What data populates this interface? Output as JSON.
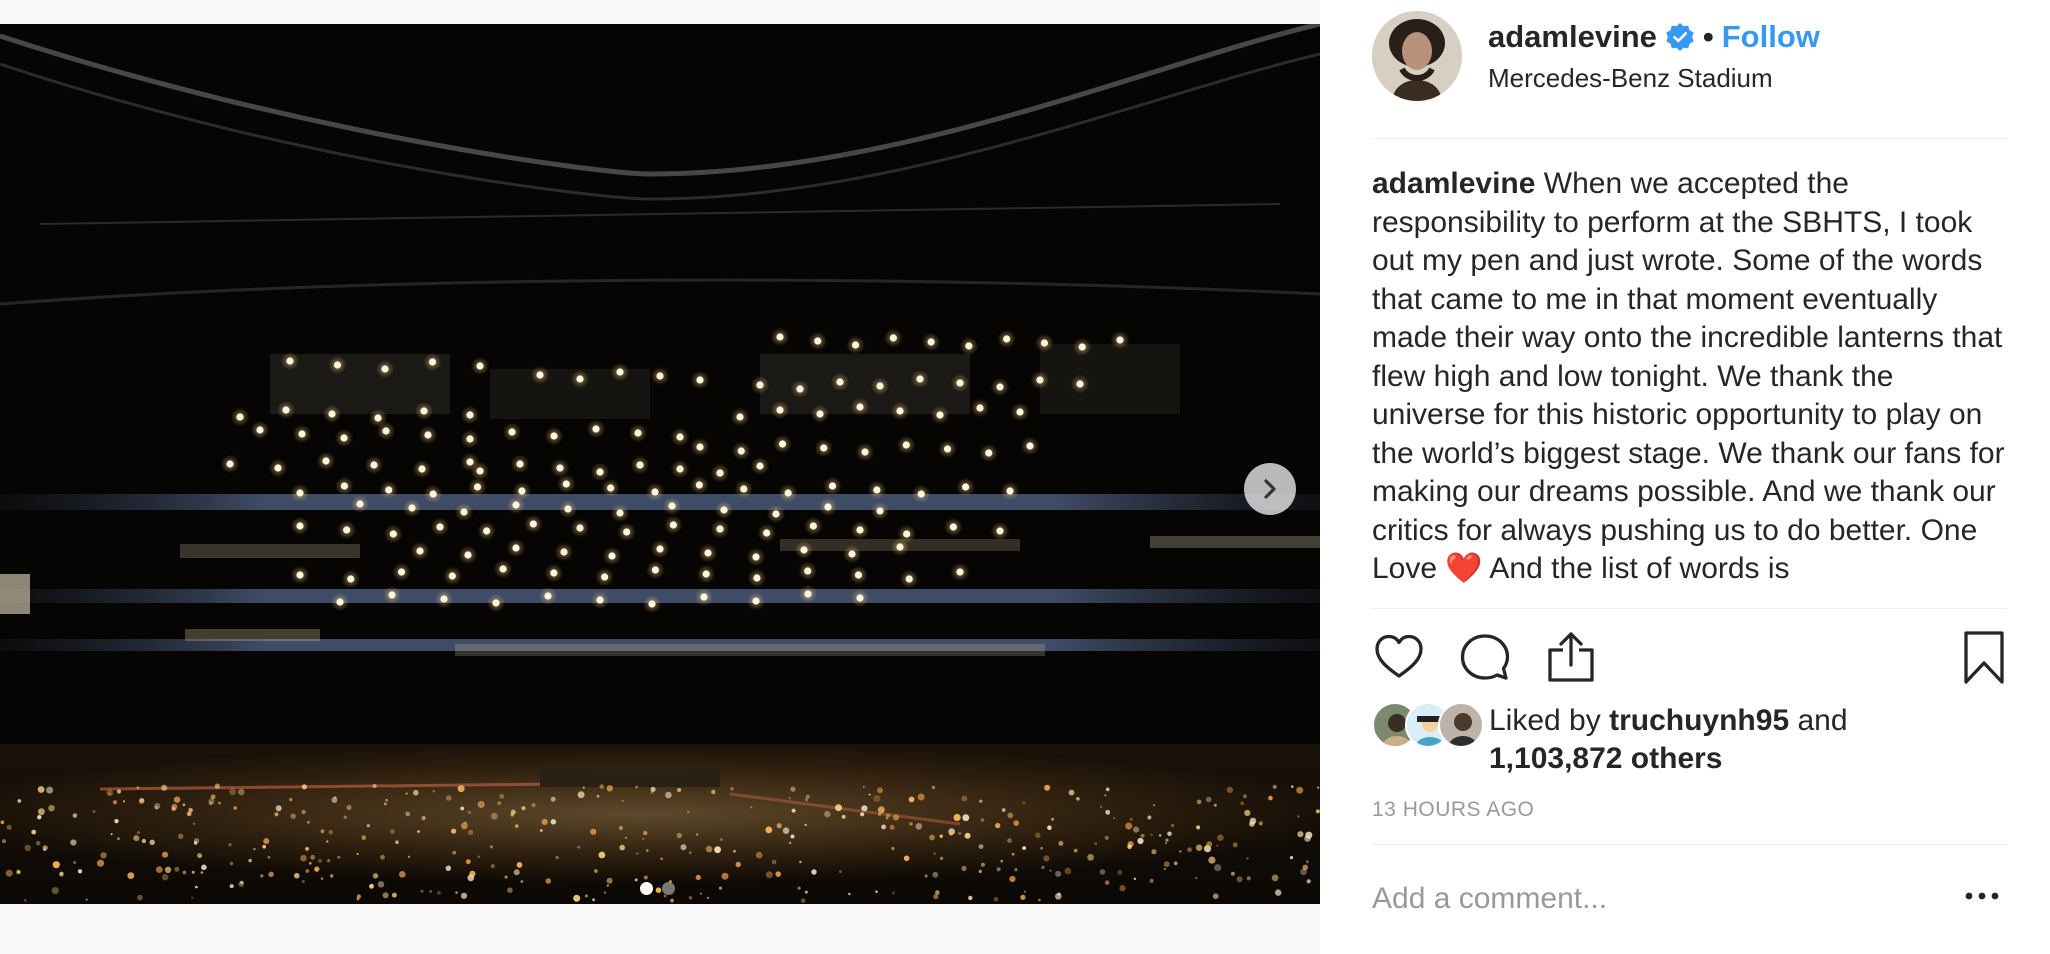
{
  "post": {
    "username": "adamlevine",
    "verified": true,
    "separator": "•",
    "follow_label": "Follow",
    "location": "Mercedes-Benz Stadium"
  },
  "media": {
    "carousel_count": 2,
    "active_index": 0,
    "next_icon": "chevron-right-icon"
  },
  "caption": {
    "username": "adamlevine",
    "text": "When we accepted the responsibility to perform at the SBHTS, I took out my pen and just wrote. Some of the words that came to me in that moment eventually made their way onto the incredible lanterns that flew high and low tonight. We thank the universe for this historic opportunity to play on the world’s biggest stage. We thank our fans for making our dreams possible. And we thank our critics for always pushing us to do better. One Love ❤️ And the list of words is"
  },
  "actions": {
    "like_icon": "heart-icon",
    "comment_icon": "comment-icon",
    "share_icon": "share-icon",
    "save_icon": "bookmark-icon"
  },
  "likes": {
    "prefix": "Liked by",
    "user": "truchuynh95",
    "conjunction": "and",
    "others": "1,103,872 others"
  },
  "timestamp": "13 HOURS AGO",
  "comment": {
    "placeholder": "Add a comment...",
    "more_icon": "ellipsis-icon"
  },
  "colors": {
    "link_blue": "#3897f0",
    "text": "#262626",
    "muted": "#999999",
    "divider": "#efefef"
  }
}
